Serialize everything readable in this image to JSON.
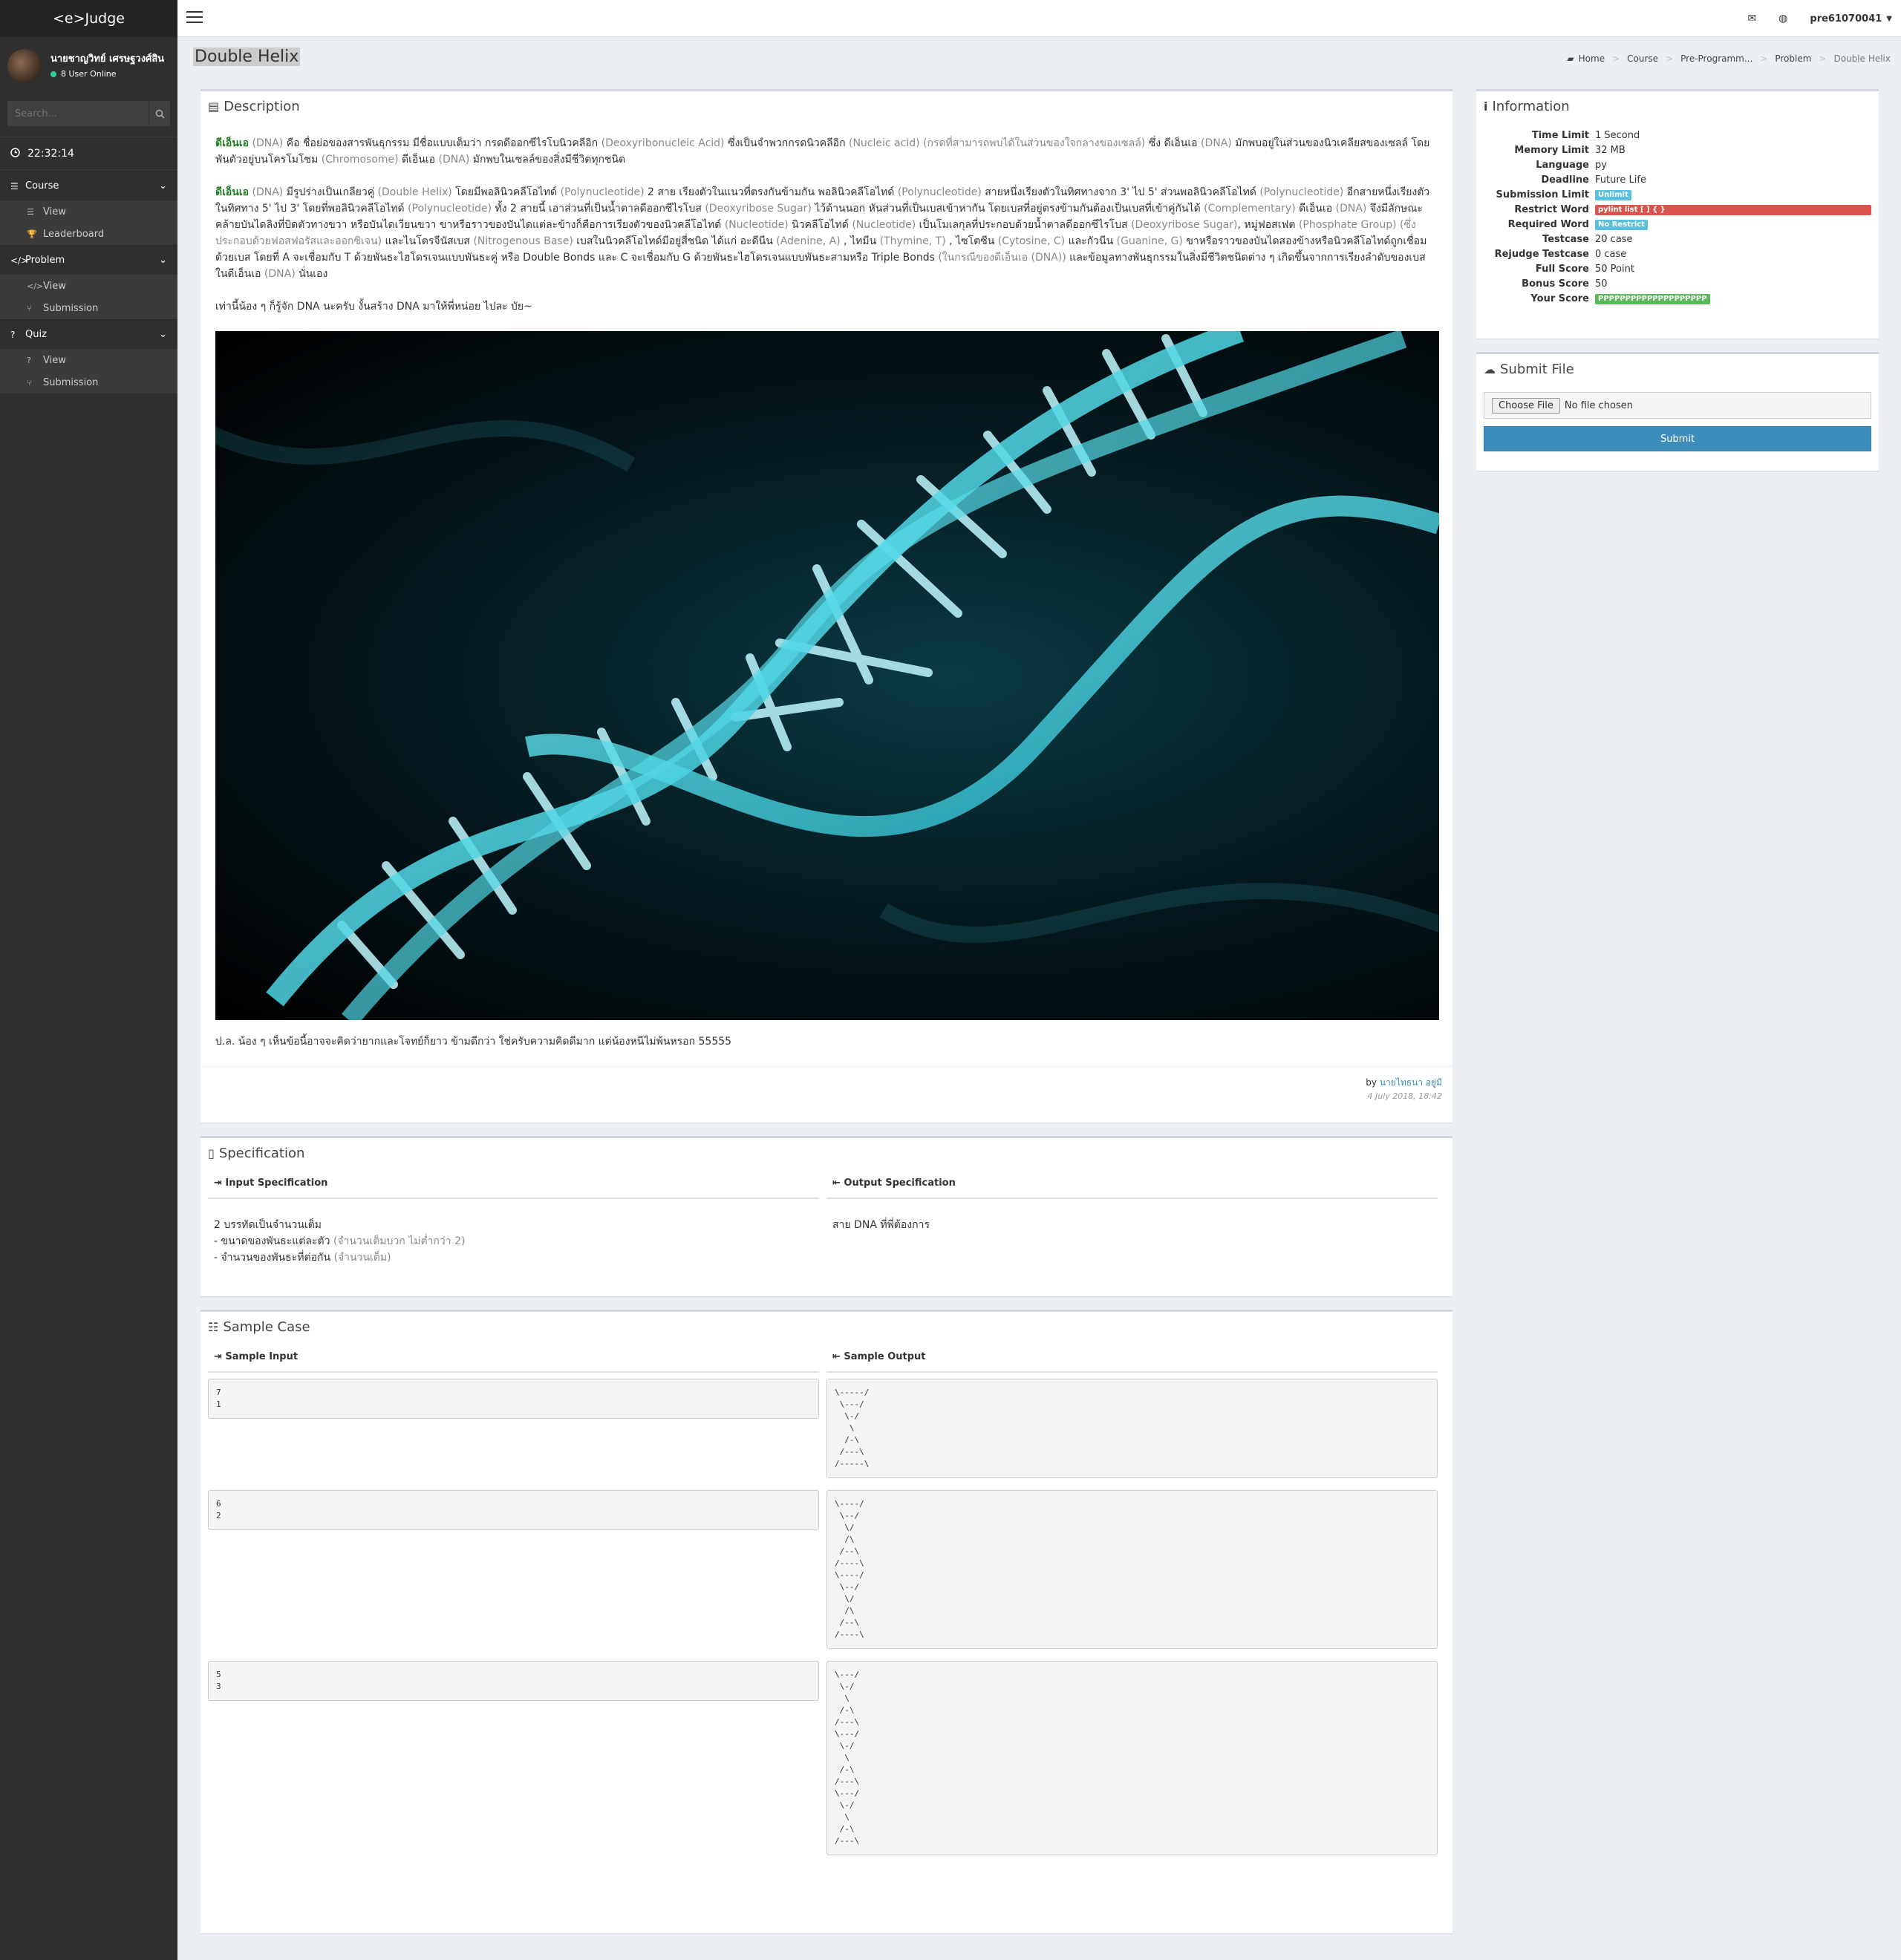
{
  "app": {
    "logo": "<e>Judge"
  },
  "user": {
    "name": "นายชาญวิทย์ เศรษฐวงศ์สิน",
    "online": "8 User Online"
  },
  "search": {
    "placeholder": "Search..."
  },
  "clock": {
    "time": "22:32:14"
  },
  "sidebar": {
    "groups": [
      {
        "label": "Course",
        "icon": "list-icon",
        "items": [
          {
            "label": "View"
          },
          {
            "label": "Leaderboard"
          }
        ]
      },
      {
        "label": "Problem",
        "icon": "code-icon",
        "items": [
          {
            "label": "View"
          },
          {
            "label": "Submission"
          }
        ]
      },
      {
        "label": "Quiz",
        "icon": "question-icon",
        "items": [
          {
            "label": "View"
          },
          {
            "label": "Submission"
          }
        ]
      }
    ]
  },
  "topbar": {
    "username": "pre61070041"
  },
  "page": {
    "title": "Double Helix"
  },
  "breadcrumb": [
    "Home",
    "Course",
    "Pre-Programm...",
    "Problem",
    "Double Helix"
  ],
  "description": {
    "title": "Description",
    "p1": [
      {
        "t": "ดีเอ็นเอ",
        "c": "hl"
      },
      {
        "t": " (DNA) ",
        "c": "gr"
      },
      {
        "t": "คือ ชื่อย่อของสารพันธุกรรม มีชื่อแบบเต็มว่า กรดดีออกซีไรโบนิวคลีอิก ",
        "c": ""
      },
      {
        "t": "(Deoxyribonucleic Acid)",
        "c": "gr"
      },
      {
        "t": " ซึ่งเป็นจำพวกกรดนิวคลีอิก ",
        "c": ""
      },
      {
        "t": "(Nucleic acid) (กรดที่สามารถพบได้ในส่วนของใจกลางของเซลล์)",
        "c": "gr"
      },
      {
        "t": " ซึ่ง ดีเอ็นเอ ",
        "c": ""
      },
      {
        "t": "(DNA)",
        "c": "gr"
      },
      {
        "t": " มักพบอยู่ในส่วนของนิวเคลียสของเซลล์ โดยพันตัวอยู่บนโครโมโซม ",
        "c": ""
      },
      {
        "t": "(Chromosome)",
        "c": "gr"
      },
      {
        "t": " ดีเอ็นเอ ",
        "c": ""
      },
      {
        "t": "(DNA)",
        "c": "gr"
      },
      {
        "t": " มักพบในเซลล์ของสิ่งมีชีวิตทุกชนิด",
        "c": ""
      }
    ],
    "p2": [
      {
        "t": "ดีเอ็นเอ",
        "c": "hl"
      },
      {
        "t": " (DNA) ",
        "c": "gr"
      },
      {
        "t": "มีรูปร่างเป็นเกลียวคู่ ",
        "c": ""
      },
      {
        "t": "(Double Helix)",
        "c": "gr"
      },
      {
        "t": " โดยมีพอลินิวคลีโอไทด์ ",
        "c": ""
      },
      {
        "t": "(Polynucleotide)",
        "c": "gr"
      },
      {
        "t": " 2 สาย เรียงตัวในแนวที่ตรงกันข้ามกัน พอลินิวคลีโอไทด์ ",
        "c": ""
      },
      {
        "t": "(Polynucleotide)",
        "c": "gr"
      },
      {
        "t": " สายหนึ่งเรียงตัวในทิศทางจาก 3' ไป 5' ส่วนพอลินิวคลีโอไทด์ ",
        "c": ""
      },
      {
        "t": "(Polynucleotide)",
        "c": "gr"
      },
      {
        "t": " อีกสายหนึ่งเรียงตัวในทิศทาง 5' ไป 3' โดยที่พอลินิวคลีโอไทด์ ",
        "c": ""
      },
      {
        "t": "(Polynucleotide)",
        "c": "gr"
      },
      {
        "t": " ทั้ง 2 สายนี้ เอาส่วนที่เป็นน้ำตาลดีออกซีไรโบส ",
        "c": ""
      },
      {
        "t": "(Deoxyribose Sugar)",
        "c": "gr"
      },
      {
        "t": " ไว้ด้านนอก หันส่วนที่เป็นเบสเข้าหากัน โดยเบสที่อยู่ตรงข้ามกันต้องเป็นเบสที่เข้าคู่กันได้ ",
        "c": ""
      },
      {
        "t": "(Complementary)",
        "c": "gr"
      },
      {
        "t": " ดีเอ็นเอ ",
        "c": ""
      },
      {
        "t": "(DNA)",
        "c": "gr"
      },
      {
        "t": " จึงมีลักษณะคล้ายบันไดลิงที่บิดตัวทางขวา หรือบันไดเวียนขวา ขาหรือราวของบันไดแต่ละข้างก็คือการเรียงตัวของนิวคลีโอไทด์ ",
        "c": ""
      },
      {
        "t": "(Nucleotide)",
        "c": "gr"
      },
      {
        "t": " นิวคลีโอไทด์ ",
        "c": ""
      },
      {
        "t": "(Nucleotide)",
        "c": "gr"
      },
      {
        "t": " เป็นโมเลกุลที่ประกอบด้วยน้ำตาลดีออกซีไรโบส ",
        "c": ""
      },
      {
        "t": "(Deoxyribose Sugar)",
        "c": "gr"
      },
      {
        "t": ", หมู่ฟอสเฟต ",
        "c": ""
      },
      {
        "t": "(Phosphate Group) (ซึ่งประกอบด้วยฟอสฟอรัสและออกซิเจน)",
        "c": "gr"
      },
      {
        "t": " และไนโตรจีนัสเบส ",
        "c": ""
      },
      {
        "t": "(Nitrogenous Base)",
        "c": "gr"
      },
      {
        "t": " เบสในนิวคลีโอไทด์มีอยู่สี่ชนิด ได้แก่ อะดีนีน ",
        "c": ""
      },
      {
        "t": "(Adenine, A)",
        "c": "gr"
      },
      {
        "t": " , ไทมีน ",
        "c": ""
      },
      {
        "t": "(Thymine, T)",
        "c": "gr"
      },
      {
        "t": " , ไซโตซีน ",
        "c": ""
      },
      {
        "t": "(Cytosine, C)",
        "c": "gr"
      },
      {
        "t": " และกัวนีน ",
        "c": ""
      },
      {
        "t": "(Guanine, G)",
        "c": "gr"
      },
      {
        "t": " ขาหรือราวของบันไดสองข้างหรือนิวคลีโอไทด์ถูกเชื่อมด้วยเบส โดยที่ A จะเชื่อมกับ T ด้วยพันธะไฮโดรเจนแบบพันธะคู่ หรือ Double Bonds และ C จะเชื่อมกับ G ด้วยพันธะไฮโดรเจนแบบพันธะสามหรือ Triple Bonds ",
        "c": ""
      },
      {
        "t": "(ในกรณีของดีเอ็นเอ (DNA))",
        "c": "gr"
      },
      {
        "t": " และข้อมูลทางพันธุกรรมในสิ่งมีชีวิตชนิดต่าง ๆ เกิดขึ้นจากการเรียงลำดับของเบสในดีเอ็นเอ ",
        "c": ""
      },
      {
        "t": "(DNA)",
        "c": "gr"
      },
      {
        "t": " นั่นเอง",
        "c": ""
      }
    ],
    "p3": "เท่านี้น้อง ๆ ก็รู้จัก DNA นะครับ งั้นสร้าง DNA มาให้พี่หน่อย ไปละ บัย~",
    "p4": "ป.ล. น้อง ๆ เห็นข้อนี้อาจจะคิดว่ายากและโจทย์ก็ยาว ข้ามดีกว่า ใช่ครับความคิดดีมาก แต่น้องหนีไม่พ้นหรอก 55555",
    "by_label": "by",
    "author": "นายไทธนา อยู่มี",
    "date": "4 July 2018, 18:42"
  },
  "information": {
    "title": "Information",
    "rows": [
      {
        "k": "Time Limit",
        "v": "1 Second"
      },
      {
        "k": "Memory Limit",
        "v": "32 MB"
      },
      {
        "k": "Language",
        "v": "py"
      },
      {
        "k": "Deadline",
        "v": "Future Life"
      },
      {
        "k": "Submission Limit",
        "badge": "Unlimit",
        "color": "#5bc0de"
      },
      {
        "k": "Restrict Word",
        "badge": "pylint list [ ] { }",
        "color": "#d9534f",
        "wide": true
      },
      {
        "k": "Required Word",
        "badge": "No Restrict",
        "color": "#5bc0de"
      },
      {
        "k": "Testcase",
        "v": "20 case"
      },
      {
        "k": "Rejudge Testcase",
        "v": "0 case"
      },
      {
        "k": "Full Score",
        "v": "50 Point"
      },
      {
        "k": "Bonus Score",
        "v": "50"
      },
      {
        "k": "Your Score",
        "badge": "PPPPPPPPPPPPPPPPPPPP",
        "color": "#5cb85c"
      }
    ]
  },
  "submit": {
    "title": "Submit File",
    "choose": "Choose File",
    "no_file": "No file chosen",
    "button": "Submit"
  },
  "specification": {
    "title": "Specification",
    "input_head": "Input Specification",
    "output_head": "Output Specification",
    "input_lines": [
      {
        "t": "2 บรรทัดเป็นจำนวนเต็ม",
        "g": ""
      },
      {
        "t": "- ขนาดของพันธะแต่ละตัว ",
        "g": "(จำนวนเต็มบวก ไม่ต่ำกว่า 2)"
      },
      {
        "t": "- จำนวนของพันธะที่ต่อกัน ",
        "g": "(จำนวนเต็ม)"
      }
    ],
    "output": "สาย DNA ที่พี่ต้องการ"
  },
  "sample": {
    "title": "Sample Case",
    "input_head": "Sample Input",
    "output_head": "Sample Output",
    "cases": [
      {
        "input": "7\n1",
        "output": "\\-----/\n \\---/\n  \\-/\n   \\\n  /-\\\n /---\\\n/-----\\"
      },
      {
        "input": "6\n2",
        "output": "\\----/\n \\--/\n  \\/\n  /\\\n /--\\\n/----\\\n\\----/\n \\--/\n  \\/\n  /\\\n /--\\\n/----\\"
      },
      {
        "input": "5\n3",
        "output": "\\---/\n \\-/\n  \\\n /-\\\n/---\\\n\\---/\n \\-/\n  \\\n /-\\\n/---\\\n\\---/\n \\-/\n  \\\n /-\\\n/---\\"
      }
    ]
  }
}
